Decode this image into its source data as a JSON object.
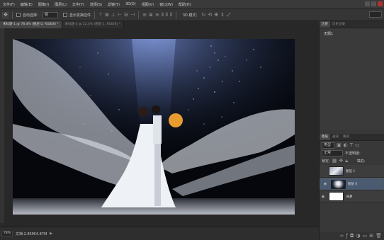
{
  "menu": {
    "items": [
      "文件(F)",
      "编辑(E)",
      "图像(I)",
      "图层(L)",
      "文字(Y)",
      "选择(S)",
      "滤镜(T)",
      "3D(D)",
      "视图(V)",
      "窗口(W)",
      "帮助(H)"
    ]
  },
  "options": {
    "auto_select_label": "自动选择：",
    "auto_select_value": "组",
    "show_transform_label": "显示变换控件",
    "mode_3d_label": "3D 模式："
  },
  "tabs": [
    {
      "label": "未标题-1 @ 78.4% (图层 0, RGB/8) *"
    },
    {
      "label": "未标题-3 @ 22.4% (图层 1, RGB/8) *"
    }
  ],
  "status": {
    "zoom": "78%",
    "doc_info": "文档:2.85M/4.87M"
  },
  "panels": {
    "history_tabs": [
      "历史",
      "历史记录"
    ],
    "history_item": "无题1",
    "layers_tabs": [
      "图层",
      "通道",
      "路径"
    ],
    "kind_label": "类型",
    "blend_mode": "正常",
    "opacity_label": "不透明度:",
    "lock_label": "锁定:",
    "fill_label": "填充:",
    "layers": [
      {
        "name": "图层 1"
      },
      {
        "name": "图层 0"
      },
      {
        "name": "背景"
      }
    ]
  },
  "colors": {
    "accent_selected": "#4a5a70",
    "orange_dot": "#e89b2f"
  }
}
